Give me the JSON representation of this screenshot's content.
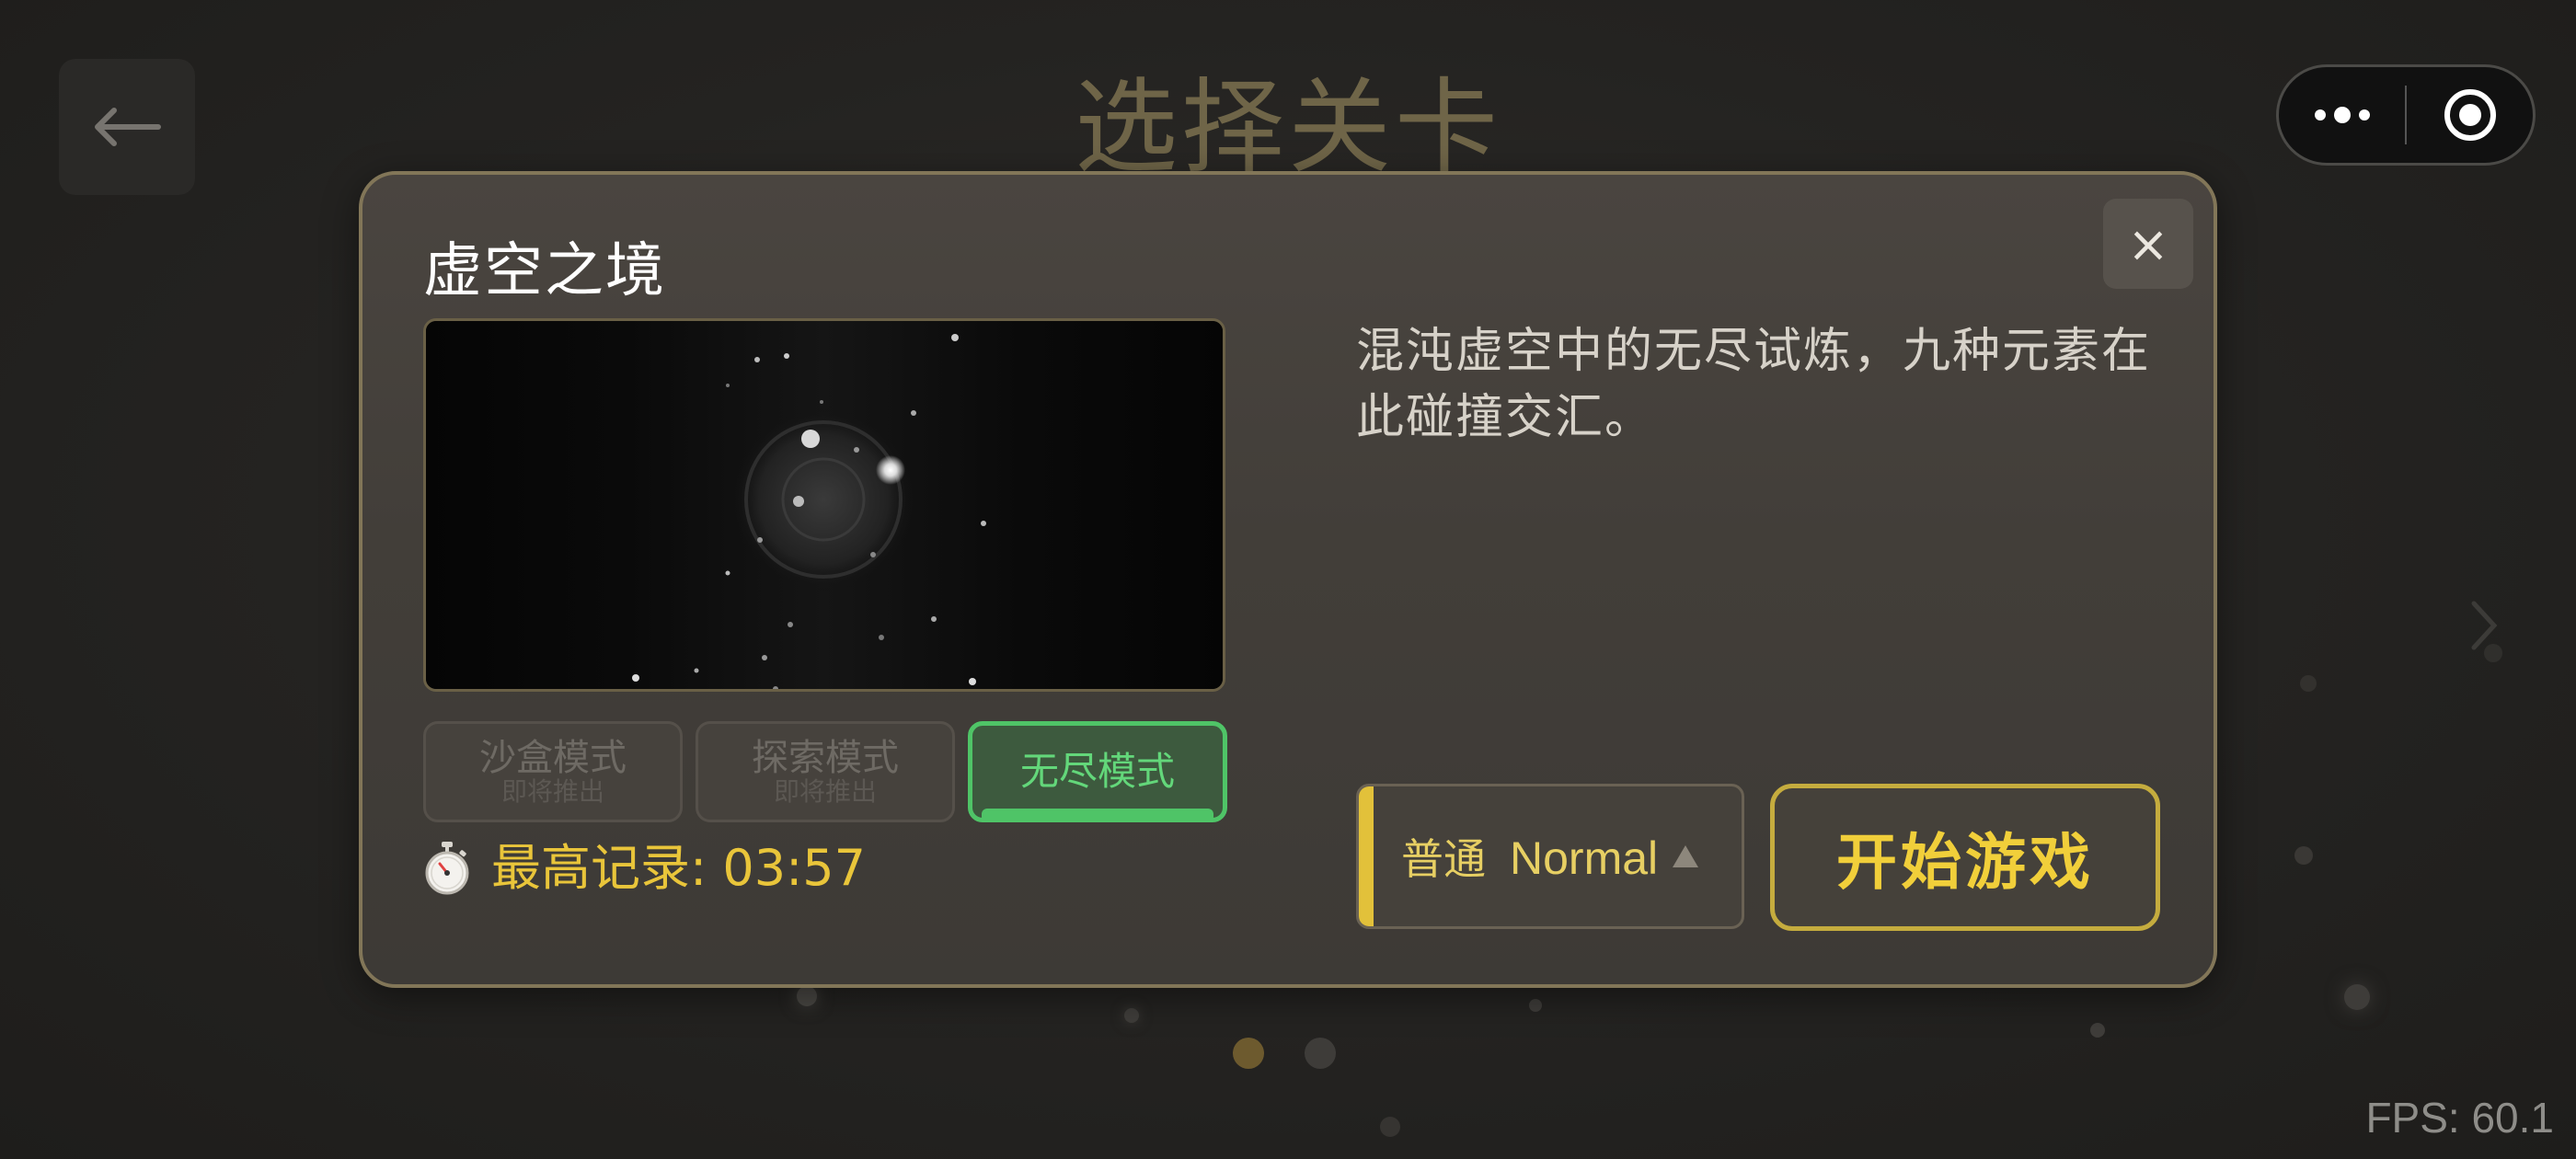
{
  "page": {
    "title": "选择关卡",
    "fps": "FPS: 60.1",
    "back_icon": "arrow-left-icon",
    "capsule": {
      "more_icon": "more-dots-icon",
      "record_icon": "target-icon"
    }
  },
  "modal": {
    "level_name": "虚空之境",
    "description": "混沌虚空中的无尽试炼，九种元素在此碰撞交汇。",
    "close_label": "×",
    "modes": [
      {
        "label": "沙盒模式",
        "sub": "即将推出",
        "state": "disabled"
      },
      {
        "label": "探索模式",
        "sub": "即将推出",
        "state": "disabled"
      },
      {
        "label": "无尽模式",
        "sub": "",
        "state": "selected"
      }
    ],
    "record": {
      "icon": "stopwatch-icon",
      "text": "最高记录: 03:57"
    },
    "difficulty": {
      "label_cn": "普通",
      "label_en": "Normal",
      "icon": "triangle-up-icon"
    },
    "start_label": "开始游戏"
  },
  "colors": {
    "accent_gold": "#e9c53a",
    "active_green": "#4fc467",
    "modal_border": "#827658"
  }
}
